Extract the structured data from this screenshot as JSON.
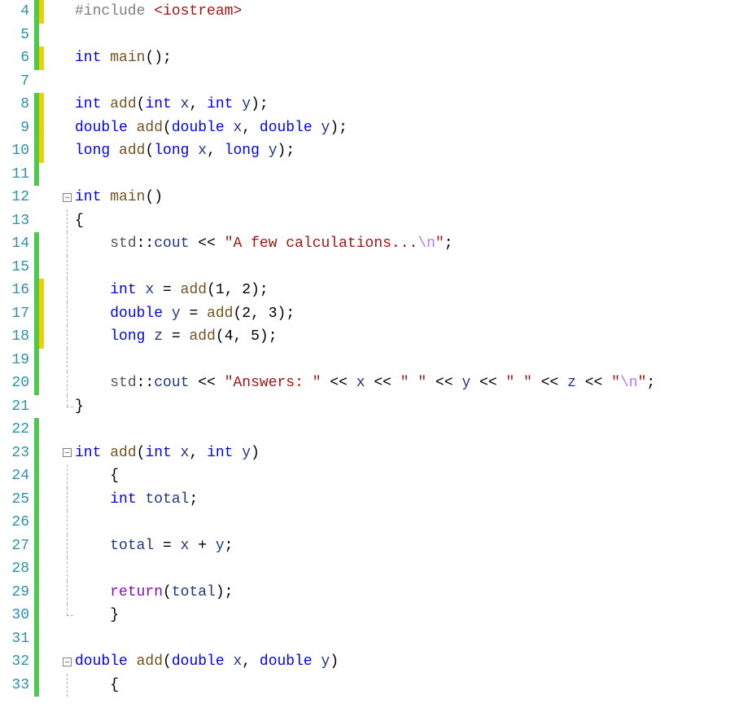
{
  "lines": [
    {
      "num": "4",
      "marks": [
        "green",
        "yellow"
      ],
      "fold": "",
      "tokens": [
        [
          "pp",
          "#include"
        ],
        [
          "pn",
          " "
        ],
        [
          "inc",
          "<iostream>"
        ]
      ]
    },
    {
      "num": "5",
      "marks": [
        "green"
      ],
      "fold": "",
      "tokens": []
    },
    {
      "num": "6",
      "marks": [
        "green",
        "yellow"
      ],
      "fold": "",
      "tokens": [
        [
          "ty",
          "int"
        ],
        [
          "pn",
          " "
        ],
        [
          "fn",
          "main"
        ],
        [
          "pn",
          "();"
        ]
      ]
    },
    {
      "num": "7",
      "marks": [],
      "fold": "",
      "tokens": []
    },
    {
      "num": "8",
      "marks": [
        "green",
        "yellow"
      ],
      "fold": "",
      "tokens": [
        [
          "ty",
          "int"
        ],
        [
          "pn",
          " "
        ],
        [
          "fn",
          "add"
        ],
        [
          "pn",
          "("
        ],
        [
          "ty",
          "int"
        ],
        [
          "pn",
          " "
        ],
        [
          "id",
          "x"
        ],
        [
          "pn",
          ", "
        ],
        [
          "ty",
          "int"
        ],
        [
          "pn",
          " "
        ],
        [
          "id",
          "y"
        ],
        [
          "pn",
          ");"
        ]
      ]
    },
    {
      "num": "9",
      "marks": [
        "green",
        "yellow"
      ],
      "fold": "",
      "tokens": [
        [
          "ty",
          "double"
        ],
        [
          "pn",
          " "
        ],
        [
          "fn",
          "add"
        ],
        [
          "pn",
          "("
        ],
        [
          "ty",
          "double"
        ],
        [
          "pn",
          " "
        ],
        [
          "id",
          "x"
        ],
        [
          "pn",
          ", "
        ],
        [
          "ty",
          "double"
        ],
        [
          "pn",
          " "
        ],
        [
          "id",
          "y"
        ],
        [
          "pn",
          ");"
        ]
      ]
    },
    {
      "num": "10",
      "marks": [
        "green",
        "yellow"
      ],
      "fold": "",
      "tokens": [
        [
          "ty",
          "long"
        ],
        [
          "pn",
          " "
        ],
        [
          "fn",
          "add"
        ],
        [
          "pn",
          "("
        ],
        [
          "ty",
          "long"
        ],
        [
          "pn",
          " "
        ],
        [
          "id",
          "x"
        ],
        [
          "pn",
          ", "
        ],
        [
          "ty",
          "long"
        ],
        [
          "pn",
          " "
        ],
        [
          "id",
          "y"
        ],
        [
          "pn",
          ");"
        ]
      ]
    },
    {
      "num": "11",
      "marks": [
        "green"
      ],
      "fold": "",
      "tokens": []
    },
    {
      "num": "12",
      "marks": [],
      "fold": "box",
      "tokens": [
        [
          "ty",
          "int"
        ],
        [
          "pn",
          " "
        ],
        [
          "fn",
          "main"
        ],
        [
          "pn",
          "()"
        ]
      ]
    },
    {
      "num": "13",
      "marks": [],
      "fold": "line",
      "tokens": [
        [
          "pn",
          "{"
        ]
      ]
    },
    {
      "num": "14",
      "marks": [
        "green"
      ],
      "fold": "line",
      "tokens": [
        [
          "pn",
          "    "
        ],
        [
          "ns",
          "std"
        ],
        [
          "pn",
          "::"
        ],
        [
          "id",
          "cout"
        ],
        [
          "pn",
          " "
        ],
        [
          "op",
          "<<"
        ],
        [
          "pn",
          " "
        ],
        [
          "str",
          "\"A few calculations..."
        ],
        [
          "esc",
          "\\n"
        ],
        [
          "str",
          "\""
        ],
        [
          "pn",
          ";"
        ]
      ]
    },
    {
      "num": "15",
      "marks": [
        "green"
      ],
      "fold": "line",
      "tokens": []
    },
    {
      "num": "16",
      "marks": [
        "green",
        "yellow"
      ],
      "fold": "line",
      "tokens": [
        [
          "pn",
          "    "
        ],
        [
          "ty",
          "int"
        ],
        [
          "pn",
          " "
        ],
        [
          "id",
          "x"
        ],
        [
          "pn",
          " = "
        ],
        [
          "fn",
          "add"
        ],
        [
          "pn",
          "("
        ],
        [
          "nlit",
          "1"
        ],
        [
          "pn",
          ", "
        ],
        [
          "nlit",
          "2"
        ],
        [
          "pn",
          ");"
        ]
      ]
    },
    {
      "num": "17",
      "marks": [
        "green",
        "yellow"
      ],
      "fold": "line",
      "tokens": [
        [
          "pn",
          "    "
        ],
        [
          "ty",
          "double"
        ],
        [
          "pn",
          " "
        ],
        [
          "id",
          "y"
        ],
        [
          "pn",
          " = "
        ],
        [
          "fn",
          "add"
        ],
        [
          "pn",
          "("
        ],
        [
          "nlit",
          "2"
        ],
        [
          "pn",
          ", "
        ],
        [
          "nlit",
          "3"
        ],
        [
          "pn",
          ");"
        ]
      ]
    },
    {
      "num": "18",
      "marks": [
        "green",
        "yellow"
      ],
      "fold": "line",
      "tokens": [
        [
          "pn",
          "    "
        ],
        [
          "ty",
          "long"
        ],
        [
          "pn",
          " "
        ],
        [
          "id",
          "z"
        ],
        [
          "pn",
          " = "
        ],
        [
          "fn",
          "add"
        ],
        [
          "pn",
          "("
        ],
        [
          "nlit",
          "4"
        ],
        [
          "pn",
          ", "
        ],
        [
          "nlit",
          "5"
        ],
        [
          "pn",
          ");"
        ]
      ]
    },
    {
      "num": "19",
      "marks": [
        "green"
      ],
      "fold": "line",
      "tokens": []
    },
    {
      "num": "20",
      "marks": [
        "green"
      ],
      "fold": "line",
      "tokens": [
        [
          "pn",
          "    "
        ],
        [
          "ns",
          "std"
        ],
        [
          "pn",
          "::"
        ],
        [
          "id",
          "cout"
        ],
        [
          "pn",
          " "
        ],
        [
          "op",
          "<<"
        ],
        [
          "pn",
          " "
        ],
        [
          "str",
          "\"Answers: \""
        ],
        [
          "pn",
          " "
        ],
        [
          "op",
          "<<"
        ],
        [
          "pn",
          " "
        ],
        [
          "id",
          "x"
        ],
        [
          "pn",
          " "
        ],
        [
          "op",
          "<<"
        ],
        [
          "pn",
          " "
        ],
        [
          "str",
          "\" \""
        ],
        [
          "pn",
          " "
        ],
        [
          "op",
          "<<"
        ],
        [
          "pn",
          " "
        ],
        [
          "id",
          "y"
        ],
        [
          "pn",
          " "
        ],
        [
          "op",
          "<<"
        ],
        [
          "pn",
          " "
        ],
        [
          "str",
          "\" \""
        ],
        [
          "pn",
          " "
        ],
        [
          "op",
          "<<"
        ],
        [
          "pn",
          " "
        ],
        [
          "id",
          "z"
        ],
        [
          "pn",
          " "
        ],
        [
          "op",
          "<<"
        ],
        [
          "pn",
          " "
        ],
        [
          "str",
          "\""
        ],
        [
          "esc",
          "\\n"
        ],
        [
          "str",
          "\""
        ],
        [
          "pn",
          ";"
        ]
      ]
    },
    {
      "num": "21",
      "marks": [],
      "fold": "corner",
      "tokens": [
        [
          "pn",
          "}"
        ]
      ]
    },
    {
      "num": "22",
      "marks": [
        "green"
      ],
      "fold": "",
      "tokens": []
    },
    {
      "num": "23",
      "marks": [
        "green"
      ],
      "fold": "box",
      "tokens": [
        [
          "ty",
          "int"
        ],
        [
          "pn",
          " "
        ],
        [
          "fn",
          "add"
        ],
        [
          "pn",
          "("
        ],
        [
          "ty",
          "int"
        ],
        [
          "pn",
          " "
        ],
        [
          "id",
          "x"
        ],
        [
          "pn",
          ", "
        ],
        [
          "ty",
          "int"
        ],
        [
          "pn",
          " "
        ],
        [
          "id",
          "y"
        ],
        [
          "pn",
          ")"
        ]
      ]
    },
    {
      "num": "24",
      "marks": [
        "green"
      ],
      "fold": "line",
      "tokens": [
        [
          "pn",
          "    {"
        ]
      ]
    },
    {
      "num": "25",
      "marks": [
        "green"
      ],
      "fold": "line",
      "tokens": [
        [
          "pn",
          "    "
        ],
        [
          "ty",
          "int"
        ],
        [
          "pn",
          " "
        ],
        [
          "id",
          "total"
        ],
        [
          "pn",
          ";"
        ]
      ]
    },
    {
      "num": "26",
      "marks": [
        "green"
      ],
      "fold": "line",
      "tokens": []
    },
    {
      "num": "27",
      "marks": [
        "green"
      ],
      "fold": "line",
      "tokens": [
        [
          "pn",
          "    "
        ],
        [
          "id",
          "total"
        ],
        [
          "pn",
          " = "
        ],
        [
          "id",
          "x"
        ],
        [
          "pn",
          " + "
        ],
        [
          "id",
          "y"
        ],
        [
          "pn",
          ";"
        ]
      ]
    },
    {
      "num": "28",
      "marks": [
        "green"
      ],
      "fold": "line",
      "tokens": []
    },
    {
      "num": "29",
      "marks": [
        "green"
      ],
      "fold": "line",
      "tokens": [
        [
          "pn",
          "    "
        ],
        [
          "ctl",
          "return"
        ],
        [
          "pn",
          "("
        ],
        [
          "id",
          "total"
        ],
        [
          "pn",
          ");"
        ]
      ]
    },
    {
      "num": "30",
      "marks": [
        "green"
      ],
      "fold": "corner",
      "tokens": [
        [
          "pn",
          "    }"
        ]
      ]
    },
    {
      "num": "31",
      "marks": [
        "green"
      ],
      "fold": "",
      "tokens": []
    },
    {
      "num": "32",
      "marks": [
        "green"
      ],
      "fold": "box",
      "tokens": [
        [
          "ty",
          "double"
        ],
        [
          "pn",
          " "
        ],
        [
          "fn",
          "add"
        ],
        [
          "pn",
          "("
        ],
        [
          "ty",
          "double"
        ],
        [
          "pn",
          " "
        ],
        [
          "id",
          "x"
        ],
        [
          "pn",
          ", "
        ],
        [
          "ty",
          "double"
        ],
        [
          "pn",
          " "
        ],
        [
          "id",
          "y"
        ],
        [
          "pn",
          ")"
        ]
      ]
    },
    {
      "num": "33",
      "marks": [
        "green"
      ],
      "fold": "line",
      "tokens": [
        [
          "pn",
          "    {"
        ]
      ]
    }
  ]
}
